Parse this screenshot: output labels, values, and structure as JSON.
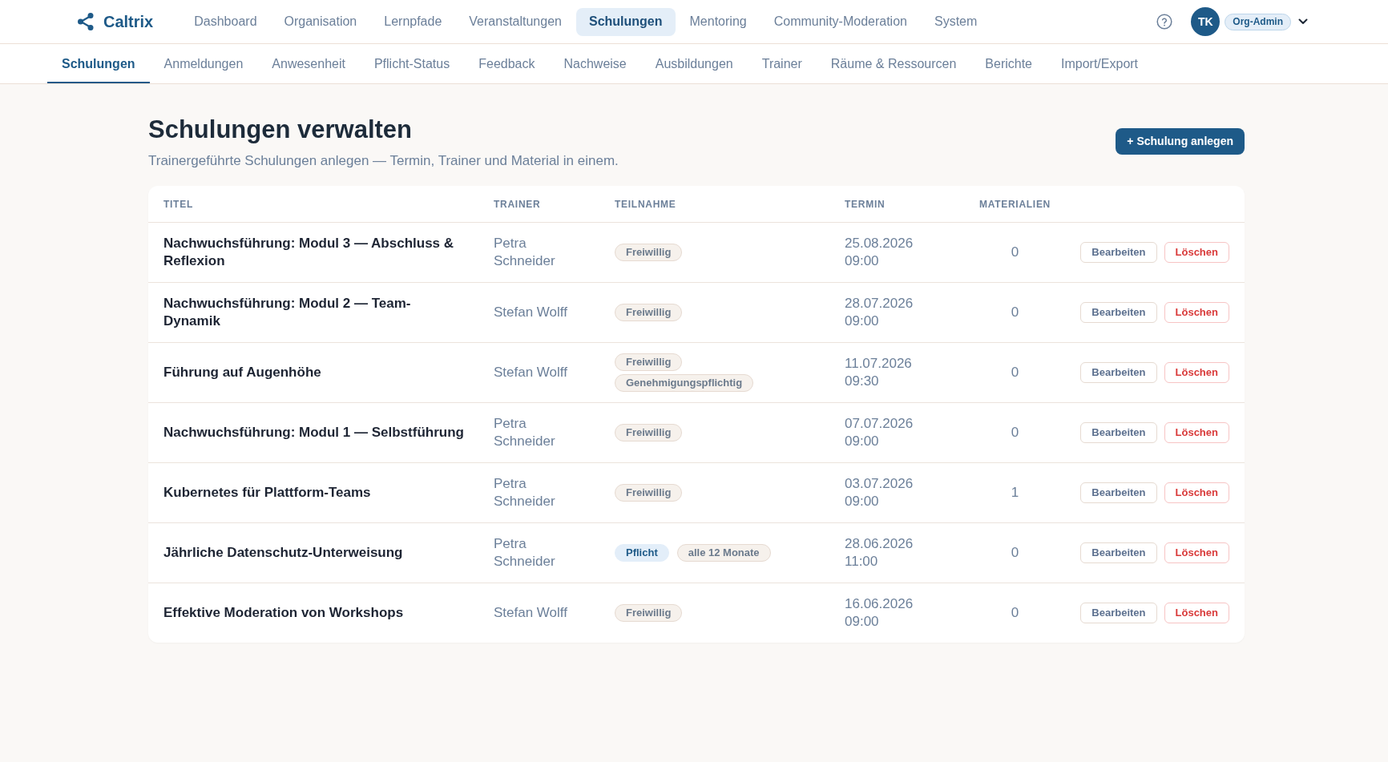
{
  "app": {
    "name": "Caltrix"
  },
  "main_nav": [
    {
      "label": "Dashboard",
      "selected": false
    },
    {
      "label": "Organisation",
      "selected": false
    },
    {
      "label": "Lernpfade",
      "selected": false
    },
    {
      "label": "Veranstaltungen",
      "selected": false
    },
    {
      "label": "Schulungen",
      "selected": true
    },
    {
      "label": "Mentoring",
      "selected": false
    },
    {
      "label": "Community-Moderation",
      "selected": false
    },
    {
      "label": "System",
      "selected": false
    }
  ],
  "user": {
    "initials": "TK",
    "role": "Org-Admin"
  },
  "sub_tabs": [
    {
      "label": "Schulungen",
      "selected": true
    },
    {
      "label": "Anmeldungen",
      "selected": false
    },
    {
      "label": "Anwesenheit",
      "selected": false
    },
    {
      "label": "Pflicht-Status",
      "selected": false
    },
    {
      "label": "Feedback",
      "selected": false
    },
    {
      "label": "Nachweise",
      "selected": false
    },
    {
      "label": "Ausbildungen",
      "selected": false
    },
    {
      "label": "Trainer",
      "selected": false
    },
    {
      "label": "Räume & Ressourcen",
      "selected": false
    },
    {
      "label": "Berichte",
      "selected": false
    },
    {
      "label": "Import/Export",
      "selected": false
    }
  ],
  "page": {
    "title": "Schulungen verwalten",
    "subtitle": "Trainergeführte Schulungen anlegen — Termin, Trainer und Material in einem.",
    "primary_button": "+ Schulung anlegen"
  },
  "table": {
    "columns": [
      "TITEL",
      "TRAINER",
      "TEILNAHME",
      "TERMIN",
      "MATERIALIEN"
    ],
    "rows": [
      {
        "title": "Nachwuchsführung: Modul 3 — Abschluss & Reflexion",
        "trainer": "Petra Schneider",
        "badges": [
          {
            "label": "Freiwillig",
            "kind": "neutral"
          }
        ],
        "termin": "25.08.2026 09:00",
        "materialien": "0",
        "actions": [
          {
            "label": "Bearbeiten",
            "kind": "edit"
          },
          {
            "label": "Löschen",
            "kind": "delete"
          }
        ]
      },
      {
        "title": "Nachwuchsführung: Modul 2 — Team-Dynamik",
        "trainer": "Stefan Wolff",
        "badges": [
          {
            "label": "Freiwillig",
            "kind": "neutral"
          }
        ],
        "termin": "28.07.2026 09:00",
        "materialien": "0",
        "actions": [
          {
            "label": "Bearbeiten",
            "kind": "edit"
          },
          {
            "label": "Löschen",
            "kind": "delete"
          }
        ]
      },
      {
        "title": "Führung auf Augenhöhe",
        "trainer": "Stefan Wolff",
        "badges": [
          {
            "label": "Freiwillig",
            "kind": "neutral"
          },
          {
            "label": "Genehmigungspflichtig",
            "kind": "neutral"
          }
        ],
        "termin": "11.07.2026 09:30",
        "materialien": "0",
        "actions": [
          {
            "label": "Bearbeiten",
            "kind": "edit"
          },
          {
            "label": "Löschen",
            "kind": "delete"
          }
        ]
      },
      {
        "title": "Nachwuchsführung: Modul 1 — Selbstführung",
        "trainer": "Petra Schneider",
        "badges": [
          {
            "label": "Freiwillig",
            "kind": "neutral"
          }
        ],
        "termin": "07.07.2026 09:00",
        "materialien": "0",
        "actions": [
          {
            "label": "Bearbeiten",
            "kind": "edit"
          },
          {
            "label": "Löschen",
            "kind": "delete"
          }
        ]
      },
      {
        "title": "Kubernetes für Plattform-Teams",
        "trainer": "Petra Schneider",
        "badges": [
          {
            "label": "Freiwillig",
            "kind": "neutral"
          }
        ],
        "termin": "03.07.2026 09:00",
        "materialien": "1",
        "actions": [
          {
            "label": "Bearbeiten",
            "kind": "edit"
          },
          {
            "label": "Löschen",
            "kind": "delete"
          }
        ]
      },
      {
        "title": "Jährliche Datenschutz-Unterweisung",
        "trainer": "Petra Schneider",
        "badges": [
          {
            "label": "Pflicht",
            "kind": "required"
          },
          {
            "label": "alle 12 Monate",
            "kind": "neutral"
          }
        ],
        "termin": "28.06.2026 11:00",
        "materialien": "0",
        "actions": [
          {
            "label": "Bearbeiten",
            "kind": "edit"
          },
          {
            "label": "Löschen",
            "kind": "delete"
          }
        ]
      },
      {
        "title": "Effektive Moderation von Workshops",
        "trainer": "Stefan Wolff",
        "badges": [
          {
            "label": "Freiwillig",
            "kind": "neutral"
          }
        ],
        "termin": "16.06.2026 09:00",
        "materialien": "0",
        "actions": [
          {
            "label": "Bearbeiten",
            "kind": "edit"
          },
          {
            "label": "Löschen",
            "kind": "delete"
          }
        ]
      }
    ]
  }
}
